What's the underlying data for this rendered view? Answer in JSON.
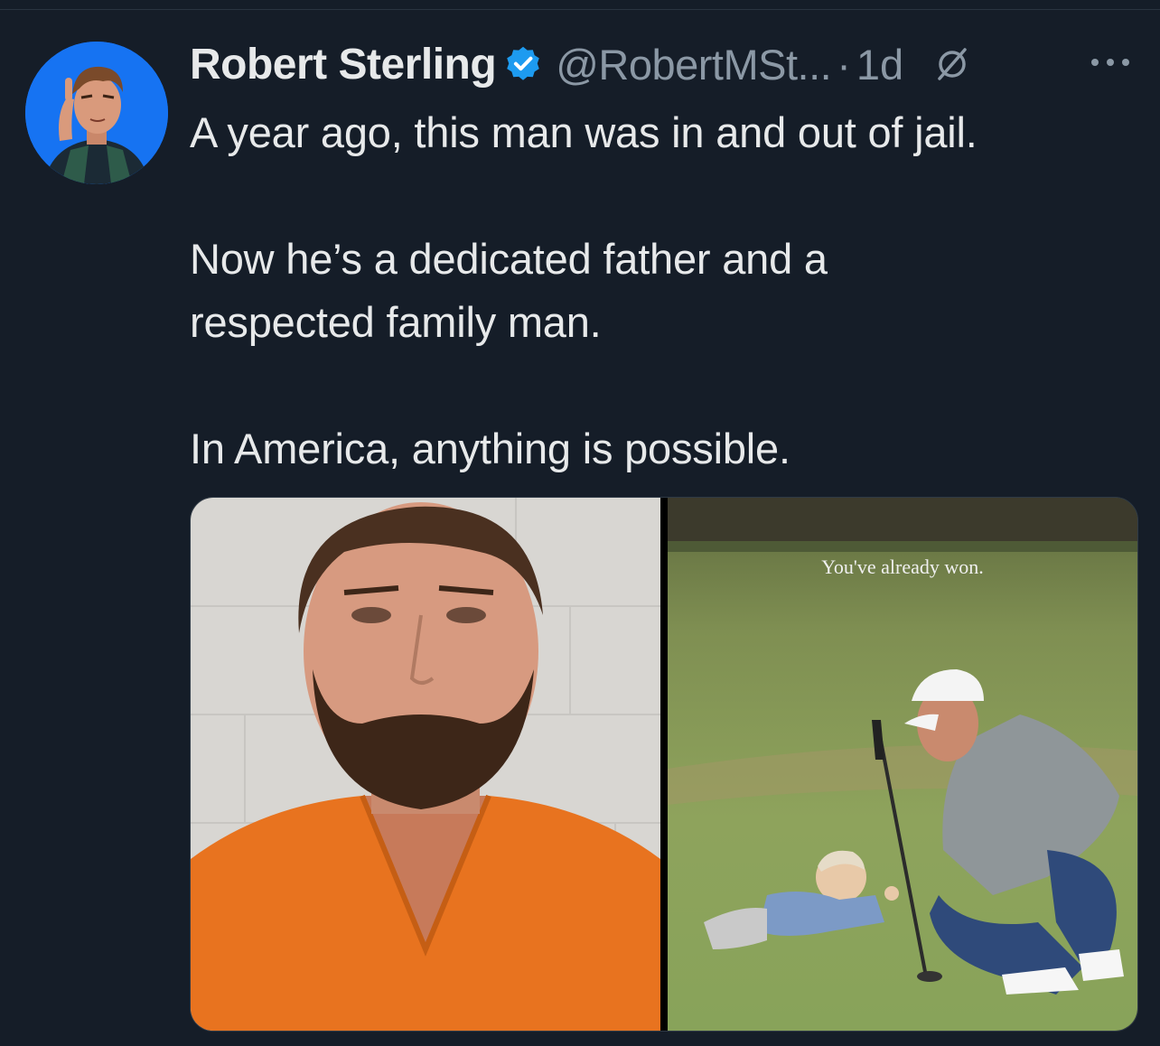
{
  "tweet": {
    "author_name": "Robert Sterling",
    "handle": "@RobertMSt...",
    "separator": "·",
    "time": "1d",
    "paragraphs": [
      "A year ago, this man was in and out of jail.",
      "Now he’s a dedicated father and a respected family man.",
      "In America, anything is possible."
    ]
  },
  "media": {
    "right_caption": "You've already won."
  },
  "icons": {
    "verified": "verified-badge-icon",
    "grok": "grok-icon",
    "more": "more-options-icon"
  },
  "colors": {
    "background": "#151d28",
    "verified": "#1d9bf0",
    "secondary_text": "#8b98a5"
  }
}
